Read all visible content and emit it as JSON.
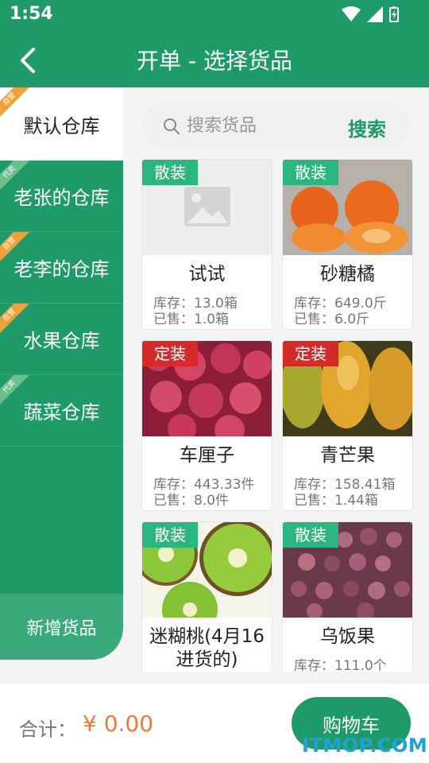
{
  "status": {
    "time": "1:54"
  },
  "header": {
    "title": "开单 - 选择货品"
  },
  "sidebar": {
    "items": [
      {
        "label": "默认仓库",
        "badge": "自营",
        "badge_color": "#f0a23a"
      },
      {
        "label": "老张的仓库",
        "badge": "代卖",
        "badge_color": "#6cc08f"
      },
      {
        "label": "老李的仓库",
        "badge": "自营",
        "badge_color": "#f0a23a"
      },
      {
        "label": "水果仓库",
        "badge": "自营",
        "badge_color": "#f0a23a"
      },
      {
        "label": "蔬菜仓库",
        "badge": "代卖",
        "badge_color": "#6cc08f"
      }
    ],
    "add_label": "新增货品"
  },
  "search": {
    "placeholder": "搜索货品",
    "button": "搜索"
  },
  "products": [
    {
      "name": "试试",
      "tag": "散装",
      "stock": "库存：13.0箱",
      "sold": "已售：1.0箱"
    },
    {
      "name": "砂糖橘",
      "tag": "散装",
      "stock": "库存：649.0斤",
      "sold": "已售：6.0斤"
    },
    {
      "name": "车厘子",
      "tag": "定装",
      "stock": "库存：443.33件",
      "sold": "已售：8.0件"
    },
    {
      "name": "青芒果",
      "tag": "定装",
      "stock": "库存：158.41箱",
      "sold": "已售：1.44箱"
    },
    {
      "name": "迷糊桃(4月16进货的)",
      "tag": "散装",
      "stock": "",
      "sold": ""
    },
    {
      "name": "乌饭果",
      "tag": "散装",
      "stock": "库存：111.0个",
      "sold": ""
    }
  ],
  "footer": {
    "total_label": "合计：",
    "total_value": "¥ 0.00",
    "cart_label": "购物车"
  },
  "watermark": "ITMOP.COM",
  "colors": {
    "primary": "#1f9b6a",
    "accent": "#f0773a"
  }
}
